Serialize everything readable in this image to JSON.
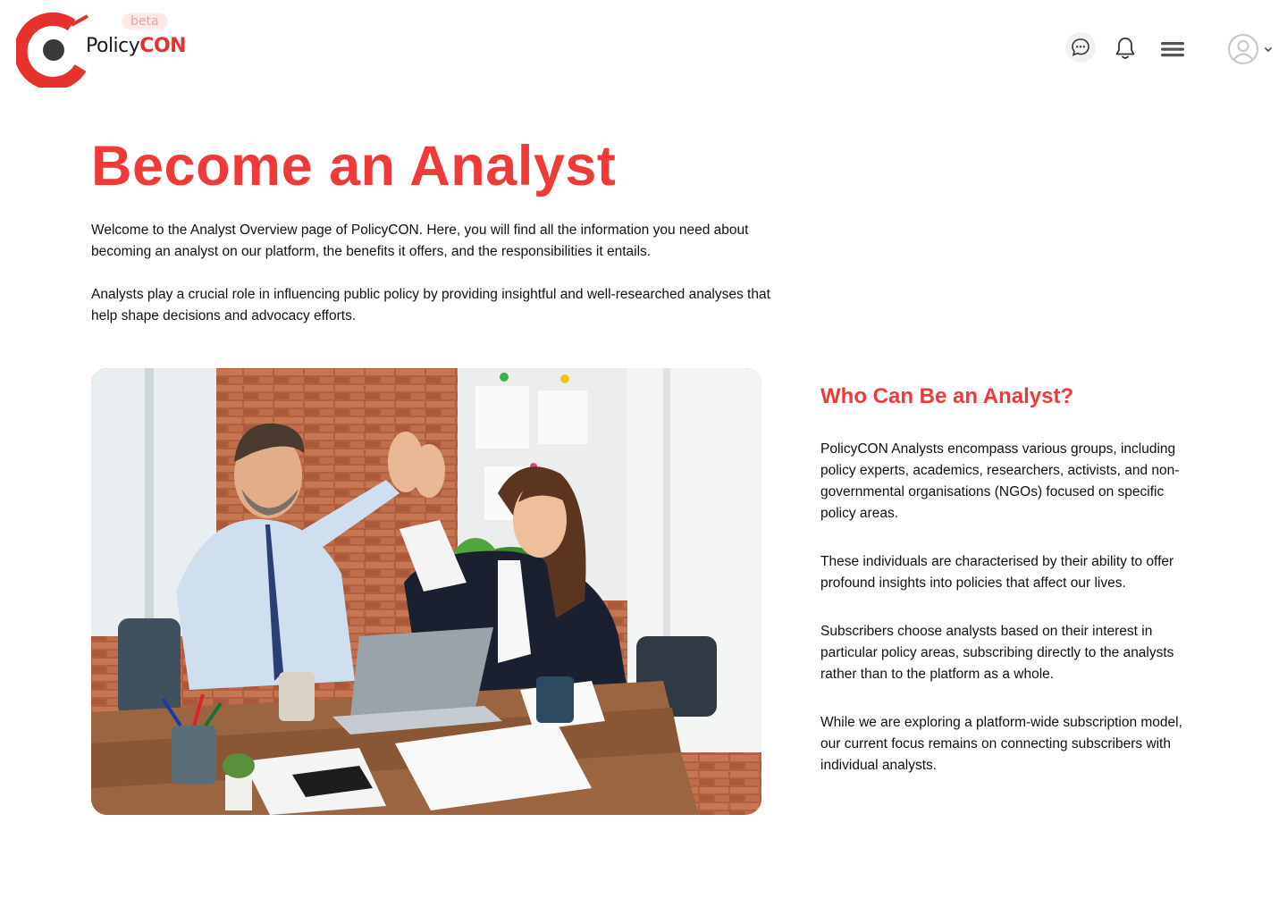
{
  "header": {
    "brand": {
      "policy": "Policy",
      "con": "CON",
      "badge": "beta"
    },
    "icons": {
      "chat": "chat-bubble-icon",
      "notifications": "bell-icon",
      "menu": "hamburger-menu-icon",
      "user": "user-avatar-icon",
      "dropdown": "chevron-down-icon"
    }
  },
  "hero": {
    "title": "Become an Analyst",
    "intro1": "Welcome to the Analyst Overview page of PolicyCON. Here, you will find all the information you need about becoming an analyst on our platform, the benefits it offers, and the responsibilities it entails.",
    "intro2": "Analysts play a crucial role in influencing public policy by providing insightful and well-researched analyses that help shape decisions and advocacy efforts."
  },
  "who": {
    "title": "Who Can Be an Analyst?",
    "p1": "PolicyCON Analysts encompass various groups, including policy experts, academics, researchers, activists, and non-governmental organisations (NGOs) focused on specific policy areas.",
    "p2": "These individuals are characterised by their ability to offer profound insights into policies that affect our lives.",
    "p3": "Subscribers choose analysts based on their interest in particular policy areas, subscribing directly to the analysts rather than to the platform as a whole.",
    "p4": "While we are exploring a platform-wide subscription model, our current focus remains on connecting subscribers with individual analysts."
  },
  "colors": {
    "accent": "#f03a38",
    "text": "#111111"
  }
}
